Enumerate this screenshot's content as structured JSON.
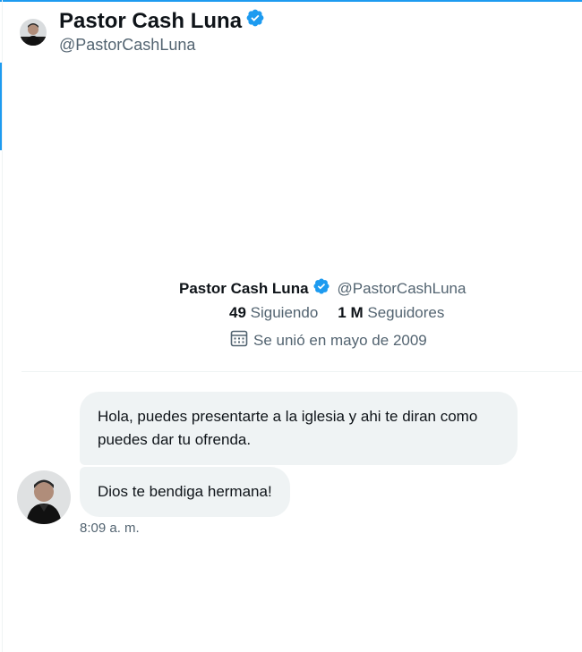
{
  "header": {
    "name": "Pastor Cash Luna",
    "handle": "@PastorCashLuna"
  },
  "profile": {
    "name": "Pastor Cash Luna",
    "handle": "@PastorCashLuna",
    "following_count": "49",
    "following_label": "Siguiendo",
    "followers_count": "1 M",
    "followers_label": "Seguidores",
    "joined": "Se unió en mayo de 2009"
  },
  "messages": [
    {
      "text": "Hola, puedes presentarte a la iglesia y ahi te diran como puedes dar tu ofrenda.",
      "sender": "me"
    },
    {
      "text": "Dios te bendiga hermana!",
      "sender": "other",
      "time": "8:09 a. m."
    }
  ],
  "icons": {
    "verified": "verified-badge-icon",
    "calendar": "calendar-icon"
  },
  "colors": {
    "accent": "#1d9bf0",
    "bubble": "#eff3f4",
    "secondary_text": "#536471"
  }
}
